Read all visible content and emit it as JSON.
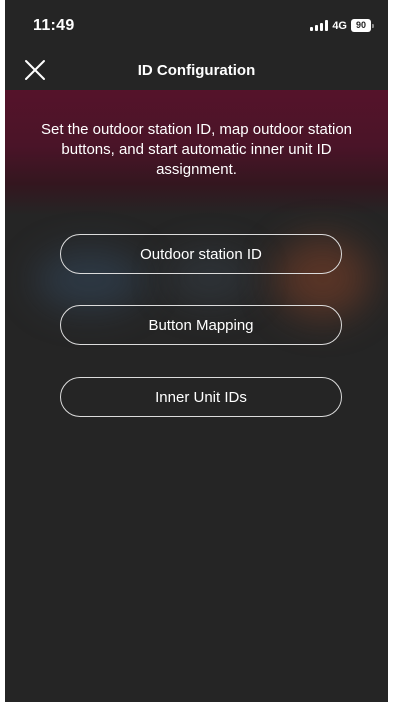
{
  "status_bar": {
    "time": "11:49",
    "network": "4G",
    "battery": "90"
  },
  "header": {
    "title": "ID Configuration",
    "close_icon": "close-icon"
  },
  "banner": {
    "description": "Set the outdoor station ID, map outdoor station buttons, and start automatic inner unit ID assignment."
  },
  "menu": {
    "items": [
      {
        "label": "Outdoor station ID"
      },
      {
        "label": "Button Mapping"
      },
      {
        "label": "Inner Unit IDs"
      }
    ]
  },
  "colors": {
    "background": "#252525",
    "banner_top": "#55132a",
    "button_border": "#dcdcdc",
    "text": "#ffffff"
  }
}
